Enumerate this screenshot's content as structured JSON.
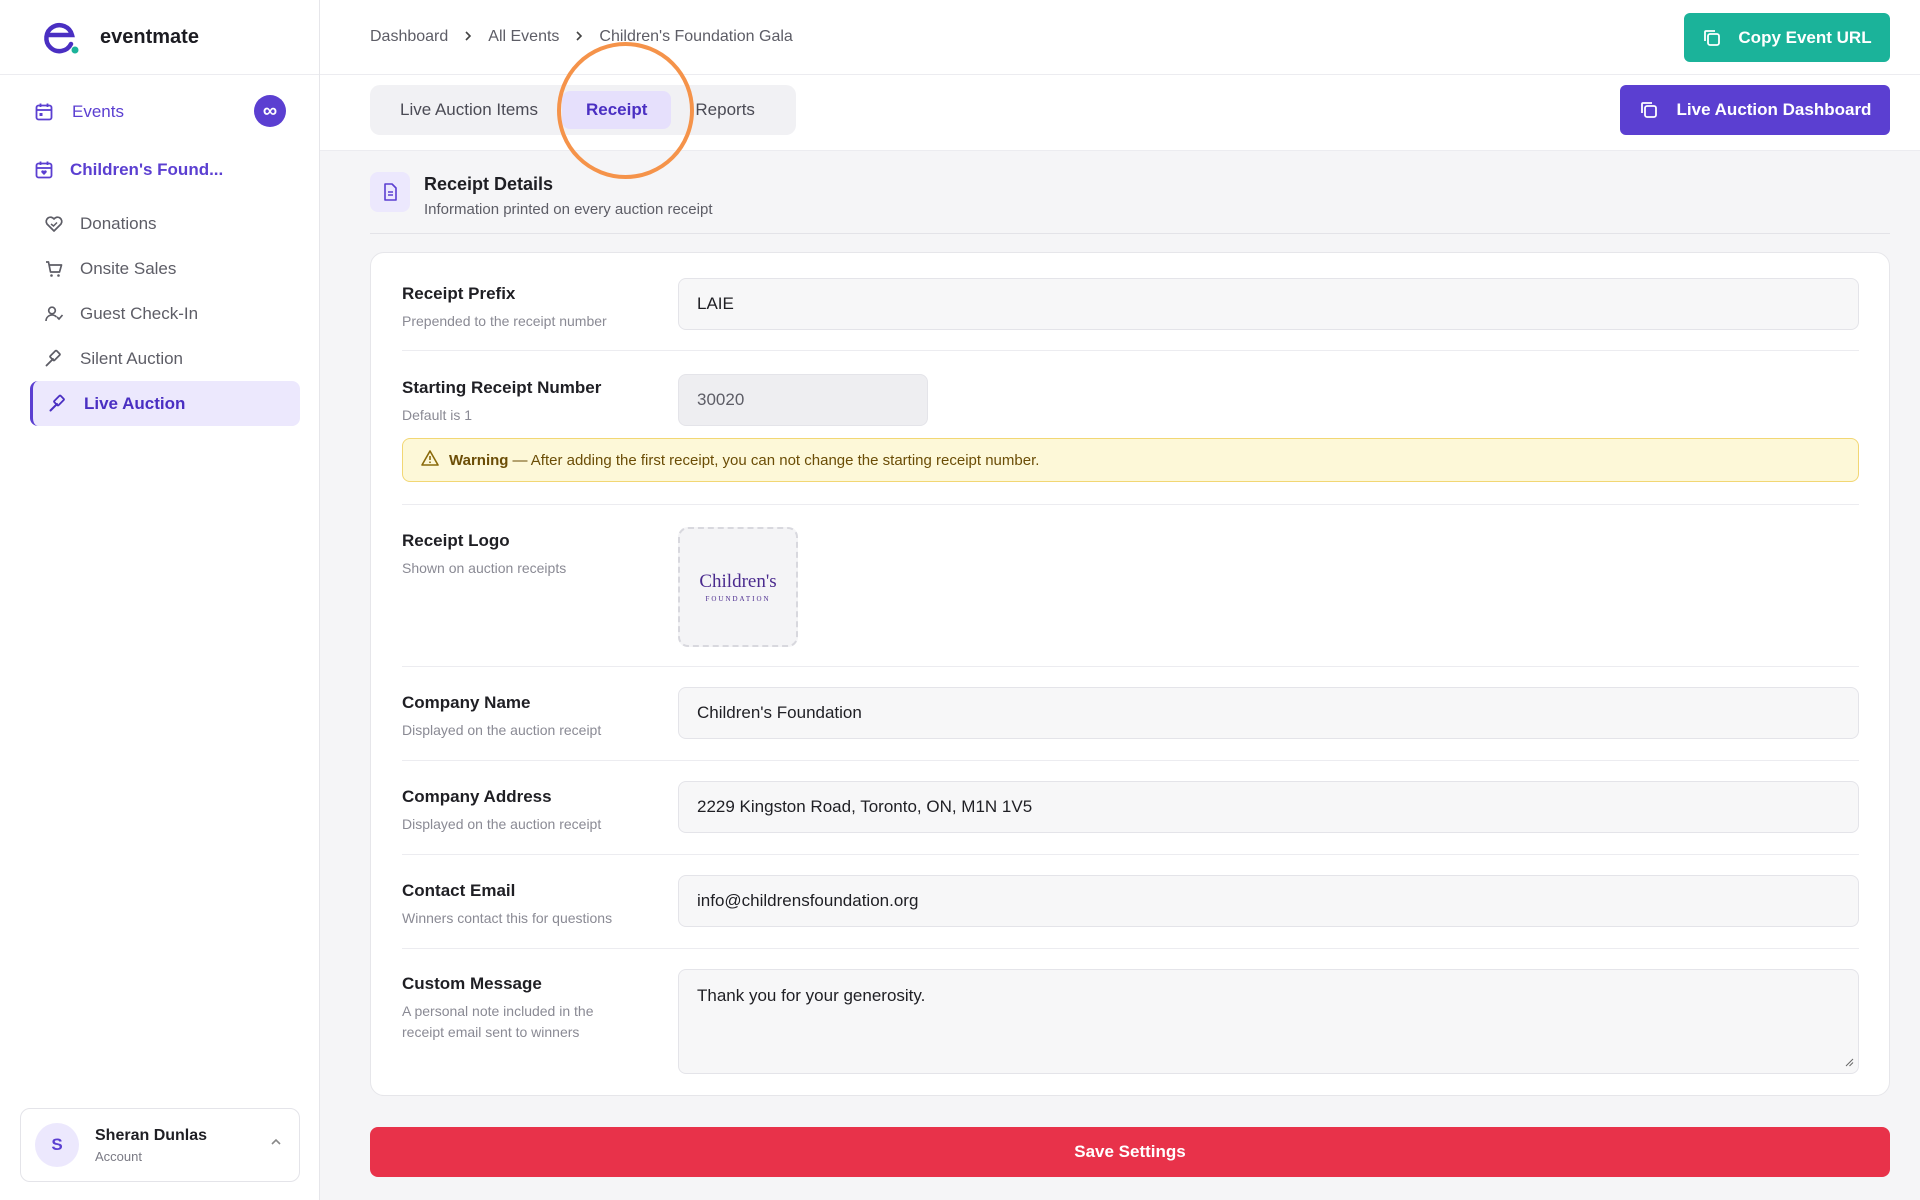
{
  "app": {
    "name": "eventmate",
    "accent": "#5b3fd1",
    "teal": "#1bb39a",
    "danger": "#e8324a"
  },
  "sidebar": {
    "events_label": "Events",
    "events_badge": "∞",
    "event_title": "Children's Found...",
    "items": [
      {
        "label": "Donations",
        "icon": "heart-handshake-icon"
      },
      {
        "label": "Onsite Sales",
        "icon": "cart-icon"
      },
      {
        "label": "Guest Check-In",
        "icon": "user-check-icon"
      },
      {
        "label": "Silent Auction",
        "icon": "gavel-icon"
      },
      {
        "label": "Live Auction",
        "icon": "gavel-icon",
        "active": true
      }
    ],
    "account": {
      "initial": "S",
      "name": "Sheran Dunlas",
      "sub": "Account"
    }
  },
  "breadcrumb": [
    "Dashboard",
    "All Events",
    "Children's Foundation Gala"
  ],
  "header": {
    "copy_url_label": "Copy Event URL",
    "dashboard_label": "Live Auction Dashboard"
  },
  "tabs": [
    {
      "label": "Live Auction Items"
    },
    {
      "label": "Receipt",
      "active": true
    },
    {
      "label": "Reports"
    }
  ],
  "section": {
    "title": "Receipt Details",
    "subtitle": "Information printed on every auction receipt"
  },
  "form": {
    "prefix": {
      "label": "Receipt Prefix",
      "help": "Prepended to the receipt number",
      "value": "LAIE"
    },
    "start_number": {
      "label": "Starting Receipt Number",
      "help": "Default is 1",
      "value": "30020"
    },
    "warning": {
      "title": "Warning",
      "message": "— After adding the first receipt, you can not change the starting receipt number."
    },
    "logo": {
      "label": "Receipt Logo",
      "help": "Shown on auction receipts",
      "logo_text": "Children's",
      "logo_sub": "FOUNDATION"
    },
    "company_name": {
      "label": "Company Name",
      "help": "Displayed on the auction receipt",
      "value": "Children's Foundation"
    },
    "company_address": {
      "label": "Company Address",
      "help": "Displayed on the auction receipt",
      "value": "2229 Kingston Road, Toronto, ON, M1N 1V5"
    },
    "contact_email": {
      "label": "Contact Email",
      "help": "Winners contact this for questions",
      "value": "info@childrensfoundation.org"
    },
    "custom_message": {
      "label": "Custom Message",
      "help": "A personal note included in the receipt email sent to winners",
      "value": "Thank you for your generosity."
    }
  },
  "save_label": "Save Settings"
}
